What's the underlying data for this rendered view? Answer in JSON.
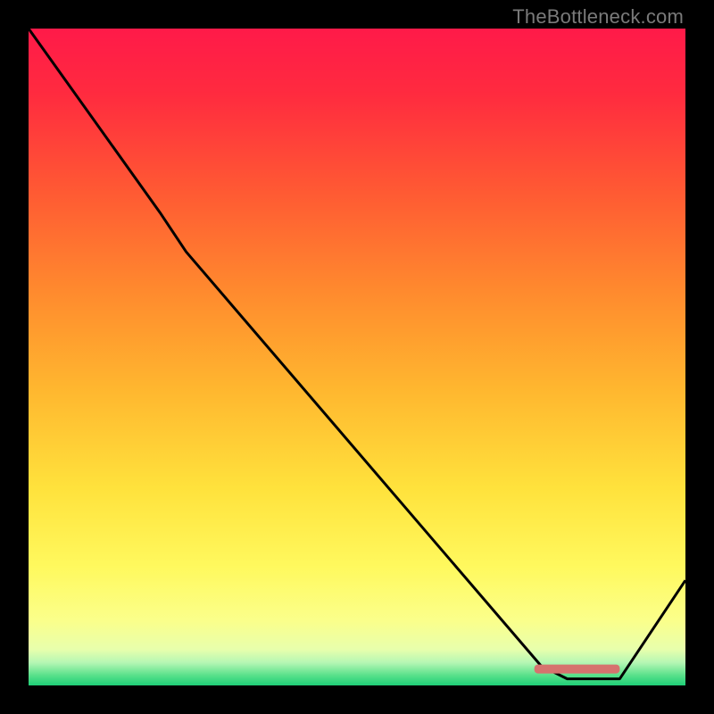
{
  "watermark": {
    "text": "TheBottleneck.com"
  },
  "gradient": {
    "stops": [
      {
        "offset": 0.0,
        "color": "#ff1a49"
      },
      {
        "offset": 0.1,
        "color": "#ff2b3f"
      },
      {
        "offset": 0.25,
        "color": "#ff5a33"
      },
      {
        "offset": 0.4,
        "color": "#ff8a2e"
      },
      {
        "offset": 0.55,
        "color": "#ffb72f"
      },
      {
        "offset": 0.7,
        "color": "#ffe23c"
      },
      {
        "offset": 0.82,
        "color": "#fff95e"
      },
      {
        "offset": 0.9,
        "color": "#fbff8a"
      },
      {
        "offset": 0.945,
        "color": "#e8ffac"
      },
      {
        "offset": 0.965,
        "color": "#b6f7b4"
      },
      {
        "offset": 0.985,
        "color": "#57e08a"
      },
      {
        "offset": 1.0,
        "color": "#1fcf77"
      }
    ]
  },
  "chart_data": {
    "type": "line",
    "title": "",
    "xlabel": "",
    "ylabel": "",
    "xlim": [
      0,
      100
    ],
    "ylim": [
      0,
      100
    ],
    "series": [
      {
        "name": "curve",
        "color": "#000000",
        "points": [
          {
            "x": 0,
            "y": 100
          },
          {
            "x": 20,
            "y": 72
          },
          {
            "x": 24,
            "y": 66
          },
          {
            "x": 78,
            "y": 3
          },
          {
            "x": 82,
            "y": 1
          },
          {
            "x": 90,
            "y": 1
          },
          {
            "x": 100,
            "y": 16
          }
        ]
      },
      {
        "name": "highlight-bar",
        "color": "#d6726e",
        "points": [
          {
            "x": 77,
            "y": 2.5
          },
          {
            "x": 90,
            "y": 2.5
          }
        ]
      }
    ]
  }
}
